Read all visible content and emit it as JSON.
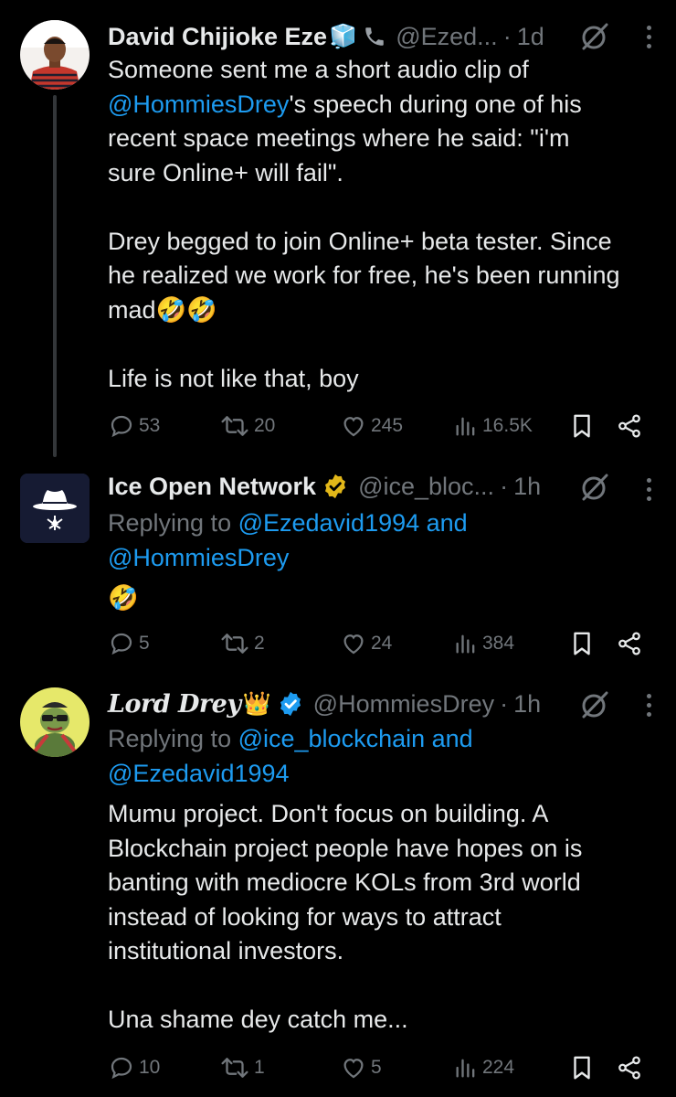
{
  "tweets": [
    {
      "name": "David Chijioke Eze",
      "name_emoji": "🧊",
      "handle": "@Ezed...",
      "time": "1d",
      "body_line1": "Someone sent me a short audio clip of",
      "mention": "@HommiesDrey",
      "body_rest": "'s speech during one of his\nrecent space meetings where he said: \"i'm\nsure Online+ will fail\".\n\nDrey begged to join Online+ beta tester. Since\nhe realized we work for free, he's been running\nmad🤣🤣\n\nLife is not like that, boy",
      "replies": "53",
      "reposts": "20",
      "likes": "245",
      "views": "16.5K"
    },
    {
      "name": "Ice Open Network",
      "handle": "@ice_bloc...",
      "time": "1h",
      "replying_prefix": "Replying to ",
      "replying_to": "@Ezedavid1994 and\n@HommiesDrey",
      "body": "🤣",
      "replies": "5",
      "reposts": "2",
      "likes": "24",
      "views": "384"
    },
    {
      "name": "Lord Drey",
      "name_emoji": "👑",
      "handle": "@HommiesDrey",
      "time": "1h",
      "replying_prefix": "Replying to ",
      "replying_to": "@ice_blockchain and\n@Ezedavid1994",
      "body": "Mumu project. Don't focus on building. A\nBlockchain project people have hopes on is\nbanting with mediocre KOLs from 3rd world\ninstead of looking for ways to attract\ninstitutional investors.\n\nUna shame dey catch me...",
      "replies": "10",
      "reposts": "1",
      "likes": "5",
      "views": "224"
    }
  ],
  "colors": {
    "background": "#000000",
    "text": "#e7e9ea",
    "muted": "#71767b",
    "link": "#1d9bf0",
    "verified_gold": "#e2b719",
    "verified_blue": "#1d9bf0"
  },
  "icons": [
    "grok-icon",
    "more-icon",
    "reply-icon",
    "repost-icon",
    "like-icon",
    "views-icon",
    "bookmark-icon",
    "share-icon",
    "phone-icon",
    "verified-gold-icon",
    "verified-blue-icon"
  ]
}
